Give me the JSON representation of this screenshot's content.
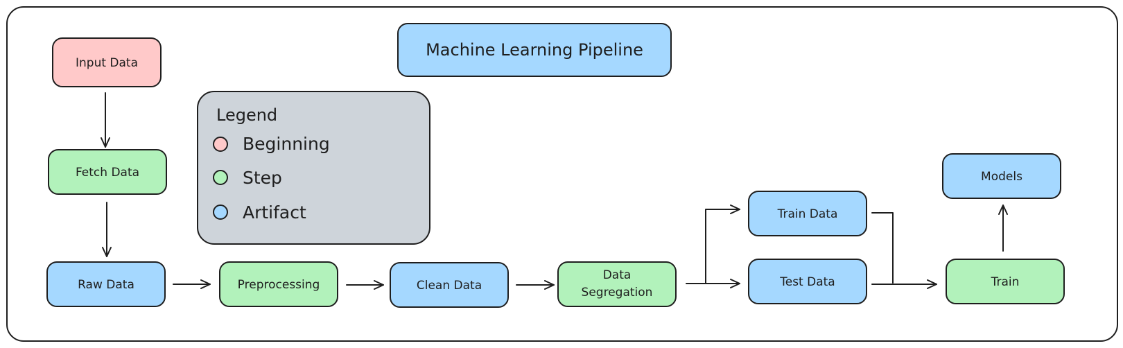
{
  "colors": {
    "beginning": "#ffc9c9",
    "step": "#b2f2bb",
    "artifact": "#a5d8ff",
    "legend_bg": "#ced4da",
    "stroke": "#1e1e1e"
  },
  "title": "Machine Learning Pipeline",
  "legend": {
    "heading": "Legend",
    "items": [
      {
        "label": "Beginning",
        "kind": "beginning"
      },
      {
        "label": "Step",
        "kind": "step"
      },
      {
        "label": "Artifact",
        "kind": "artifact"
      }
    ]
  },
  "nodes": {
    "input_data": {
      "label": "Input Data",
      "kind": "beginning"
    },
    "fetch_data": {
      "label": "Fetch Data",
      "kind": "step"
    },
    "raw_data": {
      "label": "Raw Data",
      "kind": "artifact"
    },
    "preprocessing": {
      "label": "Preprocessing",
      "kind": "step"
    },
    "clean_data": {
      "label": "Clean Data",
      "kind": "artifact"
    },
    "data_segregation": {
      "label_line1": "Data",
      "label_line2": "Segregation",
      "kind": "step"
    },
    "train_data": {
      "label": "Train Data",
      "kind": "artifact"
    },
    "test_data": {
      "label": "Test Data",
      "kind": "artifact"
    },
    "train": {
      "label": "Train",
      "kind": "step"
    },
    "models": {
      "label": "Models",
      "kind": "artifact"
    }
  },
  "edges": [
    {
      "from": "Input Data",
      "to": "Fetch Data"
    },
    {
      "from": "Fetch Data",
      "to": "Raw Data"
    },
    {
      "from": "Raw Data",
      "to": "Preprocessing"
    },
    {
      "from": "Preprocessing",
      "to": "Clean Data"
    },
    {
      "from": "Clean Data",
      "to": "Data Segregation"
    },
    {
      "from": "Data Segregation",
      "to": "Train Data"
    },
    {
      "from": "Data Segregation",
      "to": "Test Data"
    },
    {
      "from": "Train Data",
      "to": "Train"
    },
    {
      "from": "Test Data",
      "to": "Train"
    },
    {
      "from": "Train",
      "to": "Models"
    }
  ]
}
